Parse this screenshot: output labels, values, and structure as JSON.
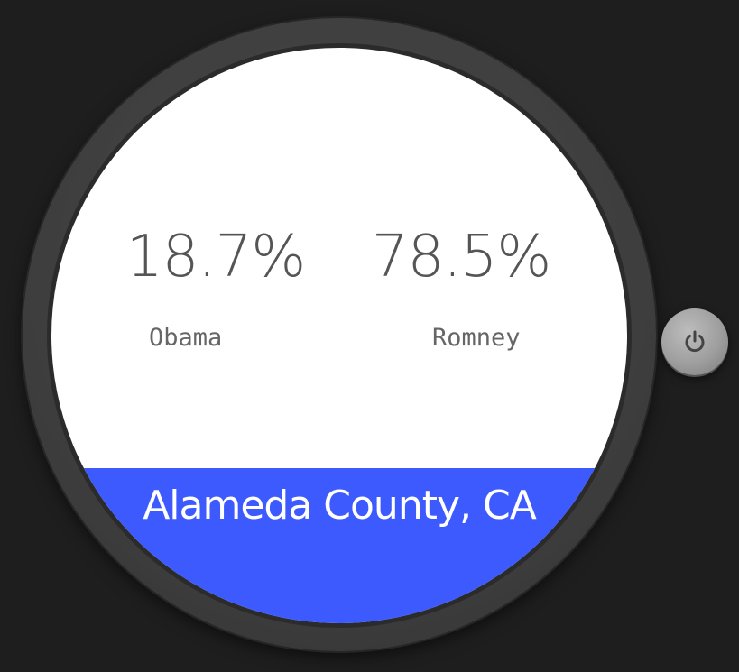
{
  "results": [
    {
      "percent": "18.7%",
      "candidate": "Obama"
    },
    {
      "percent": "78.5%",
      "candidate": "Romney"
    }
  ],
  "location": "Alameda County, CA",
  "colors": {
    "background": "#1e1e1e",
    "screen": "#ffffff",
    "banner": "#3d5afe",
    "text_primary": "#555555",
    "text_banner": "#ffffff"
  },
  "icons": {
    "power": "power-icon"
  }
}
